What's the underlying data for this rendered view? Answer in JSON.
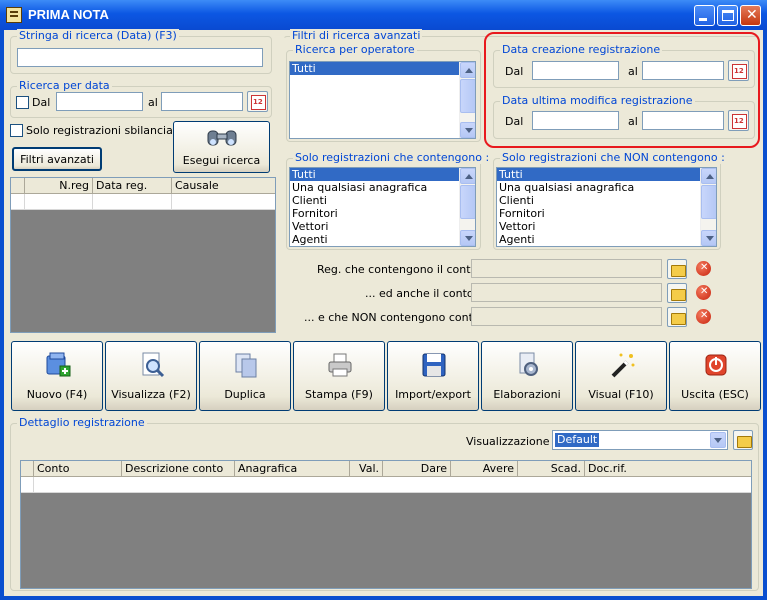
{
  "window": {
    "title": "PRIMA NOTA",
    "icon": "ledger-icon",
    "minimize_icon": "minimize-icon",
    "maximize_icon": "maximize-icon",
    "close_icon": "close-icon"
  },
  "search_string": {
    "group_label": "Stringa di ricerca (Data) (F3)",
    "value": ""
  },
  "search_by_date": {
    "group_label": "Ricerca per data",
    "dal_label": "Dal",
    "al_label": "al",
    "dal_value": "",
    "al_value": "",
    "dal_checked": false
  },
  "unbalanced_only": {
    "label": "Solo registrazioni sbilanciate",
    "checked": false
  },
  "buttons": {
    "advanced_filters": "Filtri avanzati",
    "search": "Esegui ricerca"
  },
  "results_grid": {
    "columns": [
      "N.reg",
      "Data reg.",
      "Causale"
    ]
  },
  "advanced_filters": {
    "group_label": "Filtri di ricerca avanzati",
    "operator": {
      "group_label": "Ricerca per operatore",
      "items": [
        "Tutti"
      ],
      "selected": "Tutti"
    },
    "creation_date": {
      "group_label": "Data creazione registrazione",
      "dal_label": "Dal",
      "al_label": "al",
      "dal_value": "",
      "al_value": ""
    },
    "last_modified": {
      "group_label": "Data ultima modifica registrazione",
      "dal_label": "Dal",
      "al_label": "al",
      "dal_value": "",
      "al_value": ""
    },
    "containing": {
      "group_label": "Solo registrazioni che contengono :",
      "items": [
        "Tutti",
        "Una qualsiasi anagrafica",
        "Clienti",
        "Fornitori",
        "Vettori",
        "Agenti"
      ],
      "selected": "Tutti"
    },
    "not_containing": {
      "group_label": "Solo registrazioni che NON contengono :",
      "items": [
        "Tutti",
        "Una qualsiasi anagrafica",
        "Clienti",
        "Fornitori",
        "Vettori",
        "Agenti"
      ],
      "selected": "Tutti"
    },
    "account_filters": [
      {
        "label": "Reg. che contengono il conto :",
        "value": ""
      },
      {
        "label": "... ed anche il conto :",
        "value": ""
      },
      {
        "label": "... e che NON contengono conto :",
        "value": ""
      }
    ]
  },
  "toolbar": [
    {
      "label": "Nuovo (F4)",
      "icon": "new-record-icon"
    },
    {
      "label": "Visualizza (F2)",
      "icon": "view-document-icon"
    },
    {
      "label": "Duplica",
      "icon": "duplicate-icon"
    },
    {
      "label": "Stampa (F9)",
      "icon": "printer-icon"
    },
    {
      "label": "Import/export",
      "icon": "floppy-disk-icon"
    },
    {
      "label": "Elaborazioni",
      "icon": "processing-icon"
    },
    {
      "label": "Visual (F10)",
      "icon": "magic-wand-icon"
    },
    {
      "label": "Uscita (ESC)",
      "icon": "exit-icon"
    }
  ],
  "detail": {
    "group_label": "Dettaglio registrazione",
    "view_label": "Visualizzazione :",
    "view_value": "Default",
    "columns": [
      "Conto",
      "Descrizione conto",
      "Anagrafica",
      "Val.",
      "Dare",
      "Avere",
      "Scad.",
      "Doc.rif."
    ]
  },
  "colors": {
    "titlebar": "#0c57e3",
    "highlight": "#e8191e",
    "selection": "#316ac5",
    "group_label": "#0046d5"
  }
}
